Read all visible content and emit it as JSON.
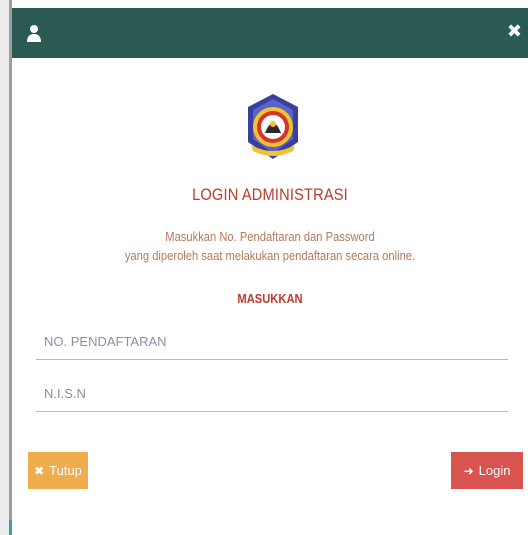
{
  "header": {
    "user_icon": "user-icon",
    "close_icon": "close-icon",
    "close_glyph": "✖"
  },
  "logo": {
    "icon": "school-emblem"
  },
  "title": "LOGIN ADMINISTRASI",
  "description": {
    "line1": "Masukkan No. Pendaftaran dan Password",
    "line2": "yang diperoleh saat melakukan pendaftaran secara online."
  },
  "section_label": "MASUKKAN",
  "fields": {
    "no_pendaftaran": {
      "placeholder": "NO. PENDAFTARAN",
      "value": ""
    },
    "nisn": {
      "placeholder": "N.I.S.N",
      "value": ""
    }
  },
  "buttons": {
    "tutup": {
      "icon": "times-icon",
      "glyph": "✖",
      "label": "Tutup"
    },
    "login": {
      "icon": "sign-in-icon",
      "glyph": "➜",
      "label": "Login"
    }
  },
  "colors": {
    "header_bg": "#2a5a52",
    "title": "#c0392b",
    "description": "#b37a5a",
    "tutup_button": "#f0ad4e",
    "login_button": "#d9534f"
  }
}
